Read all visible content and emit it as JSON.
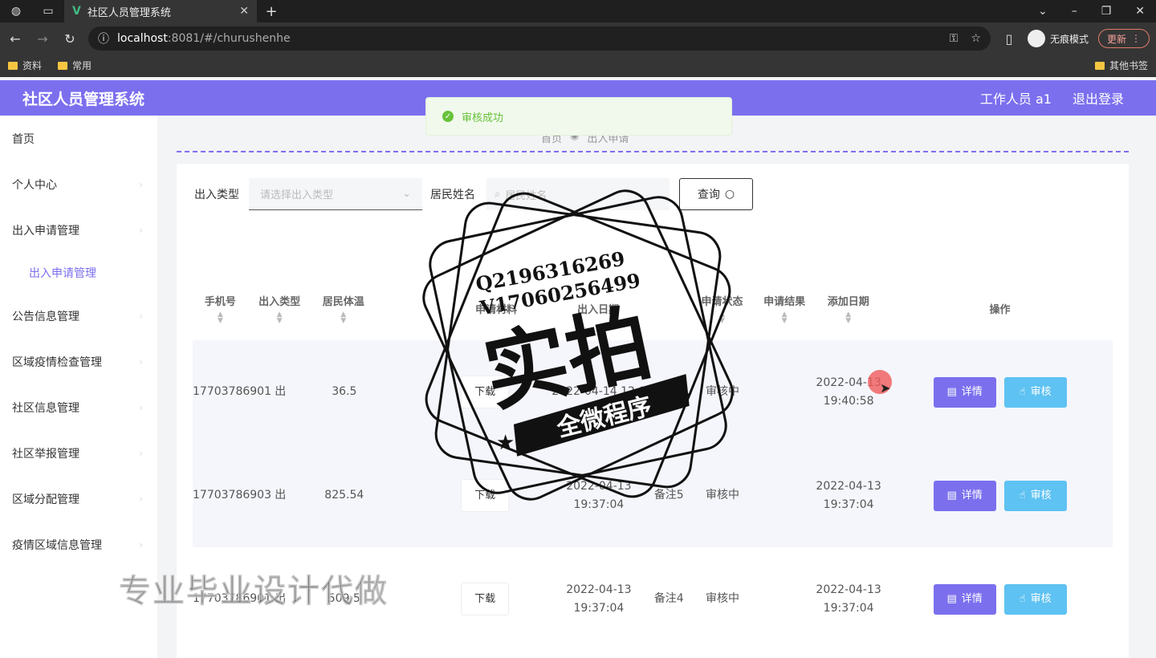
{
  "browser": {
    "tab_title": "社区人员管理系统",
    "tab_close": "✕",
    "new_tab": "+",
    "url_host": "localhost",
    "url_path": ":8081/#/churushenhe",
    "incognito_label": "无痕模式",
    "update_label": "更新",
    "bookmarks": [
      "资料",
      "常用"
    ],
    "other_bookmarks": "其他书签"
  },
  "header": {
    "title": "社区人员管理系统",
    "user": "工作人员 a1",
    "logout": "退出登录"
  },
  "sidebar": {
    "items": [
      {
        "label": "首页"
      },
      {
        "label": "个人中心"
      },
      {
        "label": "出入申请管理"
      },
      {
        "label": "出入申请管理",
        "sub": true
      },
      {
        "label": "公告信息管理"
      },
      {
        "label": "区域疫情检查管理"
      },
      {
        "label": "社区信息管理"
      },
      {
        "label": "社区举报管理"
      },
      {
        "label": "区域分配管理"
      },
      {
        "label": "疫情区域信息管理"
      }
    ]
  },
  "breadcrumb": [
    "首页",
    "出入申请"
  ],
  "filter": {
    "type_label": "出入类型",
    "type_placeholder": "请选择出入类型",
    "name_label": "居民姓名",
    "name_placeholder": "居民姓名",
    "search_label": "查询"
  },
  "table": {
    "headers": {
      "phone": "手机号",
      "type": "出入类型",
      "temp": "居民体温",
      "material": "申请材料",
      "date": "出入日期",
      "status": "申请状态",
      "result": "申请结果",
      "added": "添加日期",
      "ops": "操作"
    },
    "download_label": "下载",
    "detail_label": "详情",
    "audit_label": "审核",
    "rows": [
      {
        "phone": "17703786901",
        "type": "出",
        "temp": "36.5",
        "date": "2022-04-14 12:0",
        "note": "",
        "status": "审核中",
        "added": "2022-04-13 19:40:58"
      },
      {
        "phone": "17703786903",
        "type": "出",
        "temp": "825.54",
        "date": "2022-04-13 19:37:04",
        "note": "备注5",
        "status": "审核中",
        "added": "2022-04-13 19:37:04"
      },
      {
        "phone": "17703786901",
        "type": "出",
        "temp": "509.5",
        "date": "2022-04-13 19:37:04",
        "note": "备注4",
        "status": "审核中",
        "added": "2022-04-13 19:37:04"
      }
    ]
  },
  "toast": {
    "message": "审核成功"
  },
  "watermark": {
    "line1": "Q2196316269",
    "line2": "V17060256499",
    "big": "实拍",
    "ribbon": "全微程序",
    "bottom_text": "专业毕业设计代做"
  },
  "colors": {
    "accent": "#7b6fee",
    "audit": "#5ec2f2",
    "success": "#67c23a"
  }
}
